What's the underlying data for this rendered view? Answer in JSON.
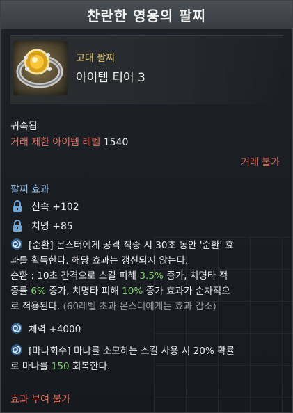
{
  "tooltip": {
    "title": "찬란한 영웅의 팔찌",
    "grade": "고대 팔찌",
    "tier": "아이템 티어 3",
    "bound": "귀속됨",
    "trade_level_label": "거래 제한 아이템 레벨",
    "trade_level_value": "1540",
    "no_trade": "거래 불가",
    "effects_title": "팔찌 효과",
    "stats": [
      {
        "label": "신속 +102",
        "icon": "lock-icon"
      },
      {
        "label": "치명 +85",
        "icon": "lock-icon"
      }
    ],
    "effect1": {
      "icon": "spiral-icon",
      "text_a": "[순환] 몬스터에게 공격 적중 시 30초 동안 '순환' 효",
      "text_b": "과를 획득한다. 해당 효과는 갱신되지 않는다.",
      "text_c1": "순환 : 10초 간격으로 스킬 피해 ",
      "val1": "3.5%",
      "text_c2": " 증가, 치명타 적",
      "text_d1": "중률 ",
      "val2": "6%",
      "text_d2": " 증가, 치명타 피해 ",
      "val3": "10%",
      "text_d3": " 증가 효과가 순차적으",
      "text_e1": "로 적용된다. ",
      "text_e2": "(60레벨 초과 몬스터에게는 효과 감소)"
    },
    "effect2": {
      "icon": "spiral-icon",
      "text": "체력 +4000"
    },
    "effect3": {
      "icon": "spiral-icon",
      "text_a": "[마나회수] 마나를 소모하는 스킬 사용 시 20% 확률",
      "text_b1": "로 마나를 ",
      "val": "150",
      "text_b2": " 회복한다."
    },
    "no_enchant": "효과 부여 불가"
  },
  "colors": {
    "accent_red": "#e36d5c",
    "accent_blue": "#9bc5ea",
    "accent_green": "#7fd36b",
    "grade_gold": "#e2c66f"
  }
}
